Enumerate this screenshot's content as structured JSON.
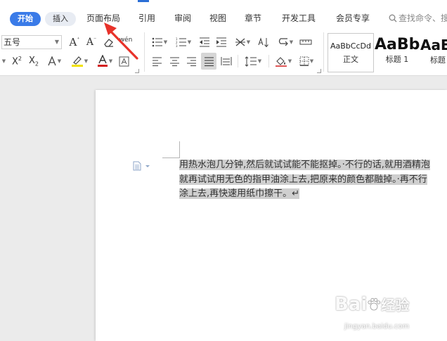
{
  "tabs": [
    {
      "label": "开始",
      "active": true
    },
    {
      "label": "插入",
      "active": false
    },
    {
      "label": "页面布局",
      "active": false
    },
    {
      "label": "引用",
      "active": false
    },
    {
      "label": "审阅",
      "active": false
    },
    {
      "label": "视图",
      "active": false
    },
    {
      "label": "章节",
      "active": false
    },
    {
      "label": "开发工具",
      "active": false
    },
    {
      "label": "会员专享",
      "active": false
    }
  ],
  "search": {
    "placeholder": "查找命令、搜",
    "icon": "search-icon"
  },
  "ribbon": {
    "font_size_value": "五号",
    "pinyin_label": "wén",
    "styles": [
      {
        "sample": "AaBbCcDd",
        "name": "正文"
      },
      {
        "sample": "AaBb",
        "name": "标题 1"
      },
      {
        "sample": "AaE",
        "name": "标题"
      }
    ],
    "highlight_color": "#f2e200",
    "font_color": "#d31f1f",
    "accent_color": "#3a7be8"
  },
  "document": {
    "lines": [
      "用热水泡几分钟,然后就试试能不能抠掉。·不行的话,就用酒精泡",
      "就再试试用无色的指甲油涂上去,把原来的颜色都融掉。·再不行",
      "涂上去,再快速用纸巾擦干。↵"
    ]
  },
  "watermark": {
    "brand": "Bai",
    "brand_suffix": "经验",
    "url": "jingyan.baidu.com"
  }
}
